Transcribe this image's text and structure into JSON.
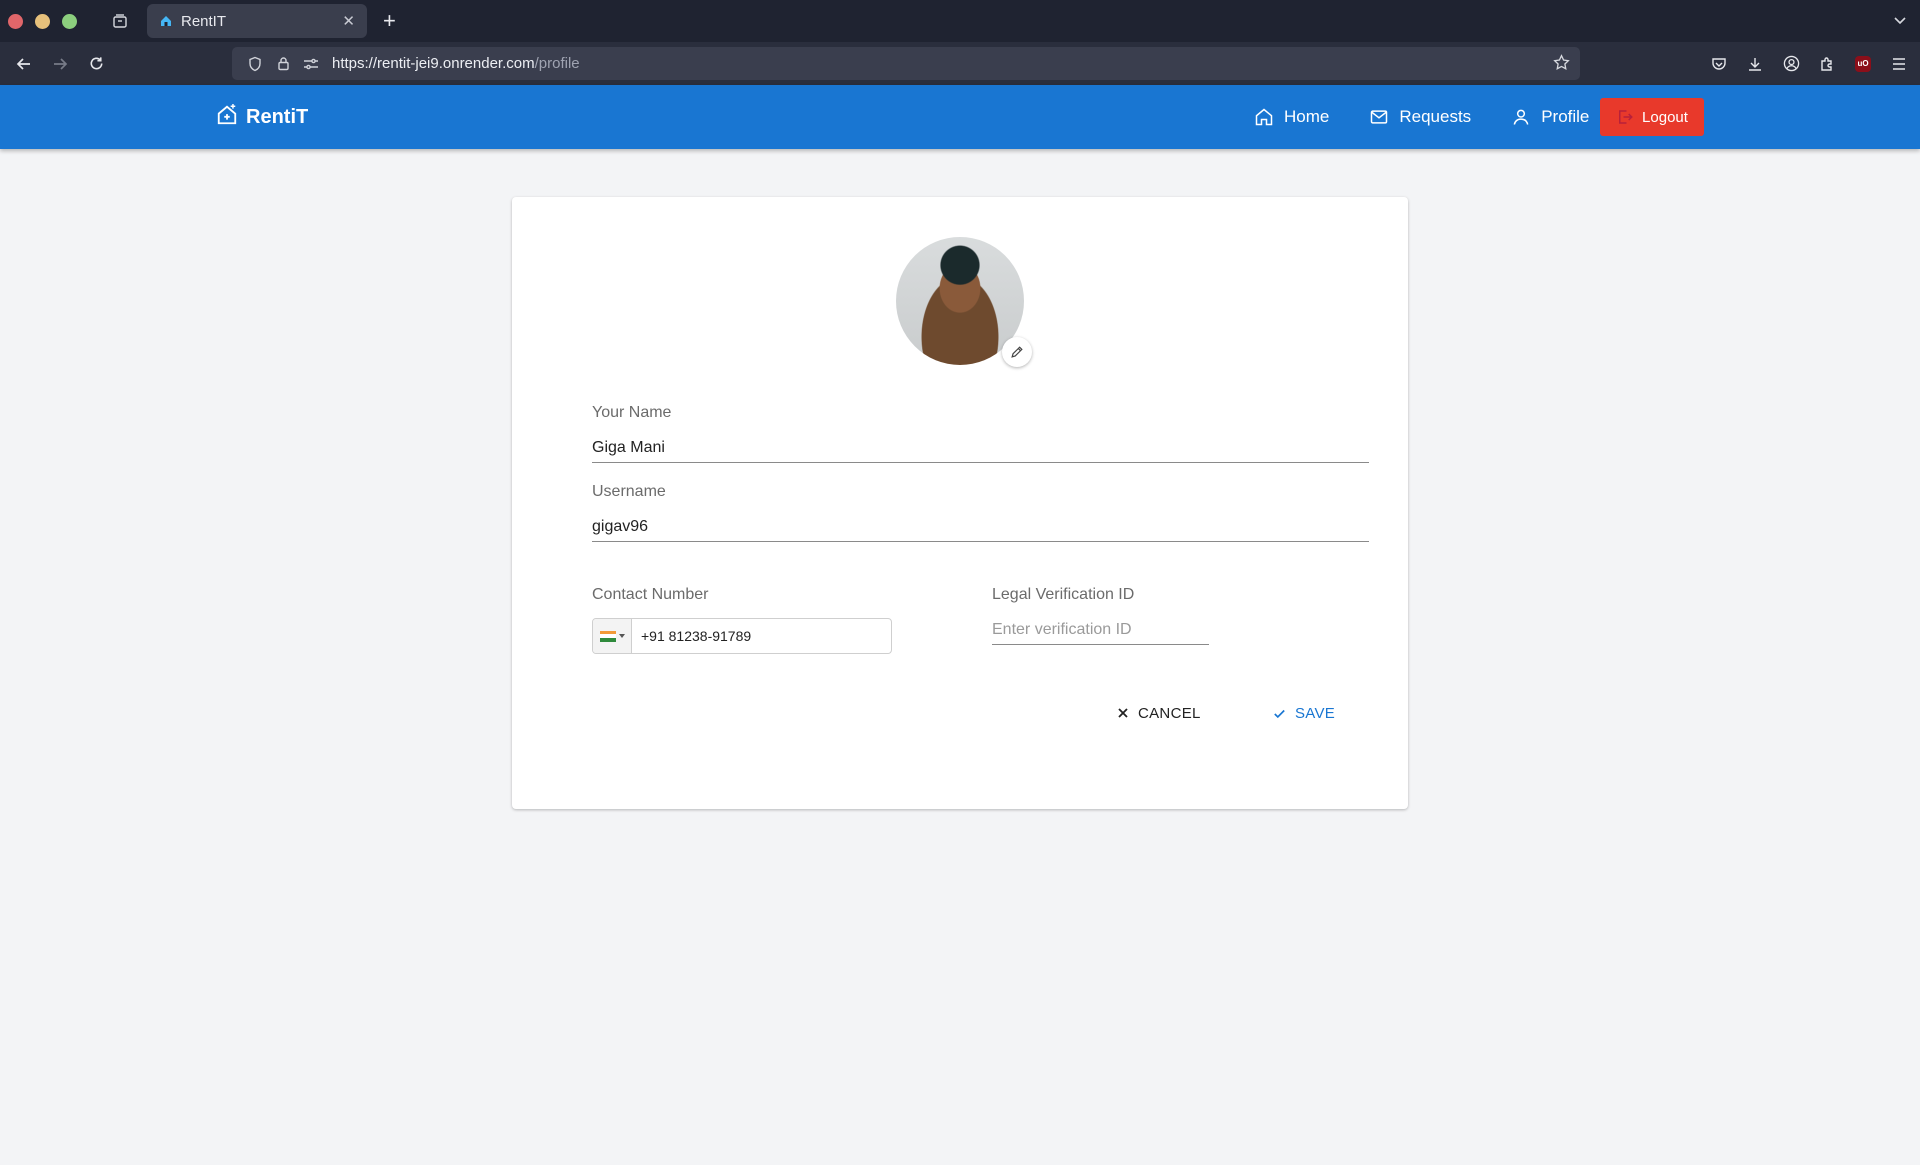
{
  "browser": {
    "tab_title": "RentIT",
    "url_host": "https://rentit-jei9.onrender.com",
    "url_path": "/profile"
  },
  "app": {
    "brand": "RentiT",
    "nav": {
      "home": "Home",
      "requests": "Requests",
      "profile": "Profile",
      "logout": "Logout"
    },
    "colors": {
      "header": "#1976d2",
      "logout": "#e8392b",
      "primary": "#1976d2"
    }
  },
  "profile": {
    "name_label": "Your Name",
    "name_value": "Giga Mani",
    "username_label": "Username",
    "username_value": "gigav96",
    "contact_label": "Contact Number",
    "contact_value": "+91 81238-91789",
    "country_flag": "flag-india-icon",
    "legal_label": "Legal Verification ID",
    "legal_placeholder": "Enter verification ID",
    "legal_value": "",
    "cancel_label": "CANCEL",
    "save_label": "SAVE"
  }
}
